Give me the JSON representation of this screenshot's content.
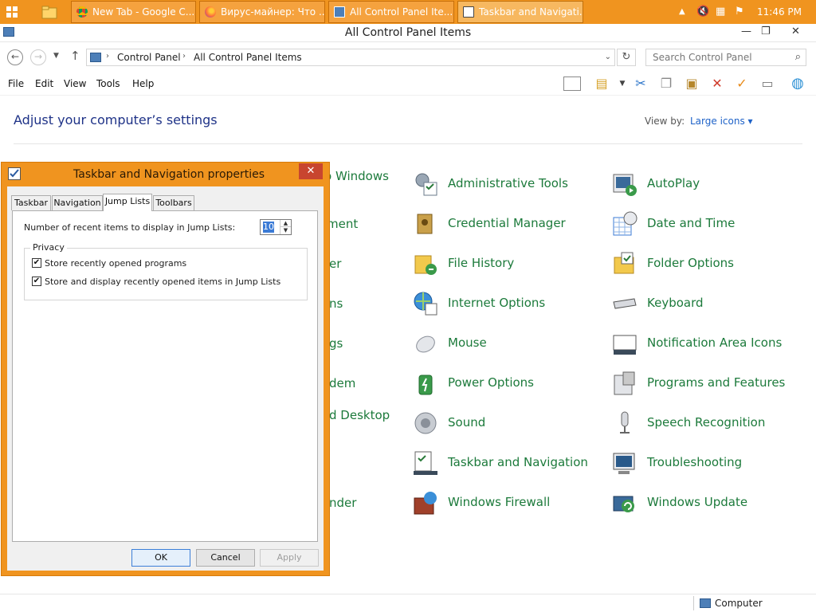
{
  "taskbar": {
    "buttons": [
      {
        "label": "New Tab - Google C...",
        "icon": "chrome-icon"
      },
      {
        "label": "Вирус-майнер: Что ...",
        "icon": "firefox-icon"
      },
      {
        "label": "All Control Panel Ite...",
        "icon": "control-panel-icon"
      },
      {
        "label": "Taskbar and Navigati...",
        "icon": "taskbar-properties-icon"
      }
    ],
    "clock": "11:46 PM"
  },
  "window": {
    "title": "All Control Panel Items",
    "minimize": "—",
    "maximize": "❐",
    "close": "✕"
  },
  "address": {
    "segments": [
      "Control Panel",
      "All Control Panel Items"
    ],
    "search_placeholder": "Search Control Panel"
  },
  "menu": [
    "File",
    "Edit",
    "View",
    "Tools",
    "Help"
  ],
  "main": {
    "heading": "Adjust your computer’s settings",
    "view_by_label": "View by:",
    "view_by_value": "Large icons ▾",
    "partial_items": [
      "o Windows",
      "ment",
      "er",
      "ns",
      "gs",
      "dem",
      "d Desktop",
      "nder"
    ],
    "col2": [
      "Administrative Tools",
      "Credential Manager",
      "File History",
      "Internet Options",
      "Mouse",
      "Power Options",
      "Sound",
      "Taskbar and Navigation",
      "Windows Firewall"
    ],
    "col3": [
      "AutoPlay",
      "Date and Time",
      "Folder Options",
      "Keyboard",
      "Notification Area Icons",
      "Programs and Features",
      "Speech Recognition",
      "Troubleshooting",
      "Windows Update"
    ]
  },
  "status": {
    "computer": "Computer"
  },
  "dialog": {
    "title": "Taskbar and Navigation properties",
    "tabs": [
      "Taskbar",
      "Navigation",
      "Jump Lists",
      "Toolbars"
    ],
    "active_tab": "Jump Lists",
    "recent_items_label": "Number of recent items to display in Jump Lists:",
    "recent_items_value": "10",
    "privacy_label": "Privacy",
    "checkboxes": [
      {
        "label": "Store recently opened programs",
        "checked": true
      },
      {
        "label": "Store and display recently opened items in Jump Lists",
        "checked": true
      }
    ],
    "buttons": {
      "ok": "OK",
      "cancel": "Cancel",
      "apply": "Apply"
    }
  },
  "colors": {
    "taskbar": "#f0941f",
    "link_green": "#1c7a3b",
    "heading_blue": "#1e3287"
  }
}
